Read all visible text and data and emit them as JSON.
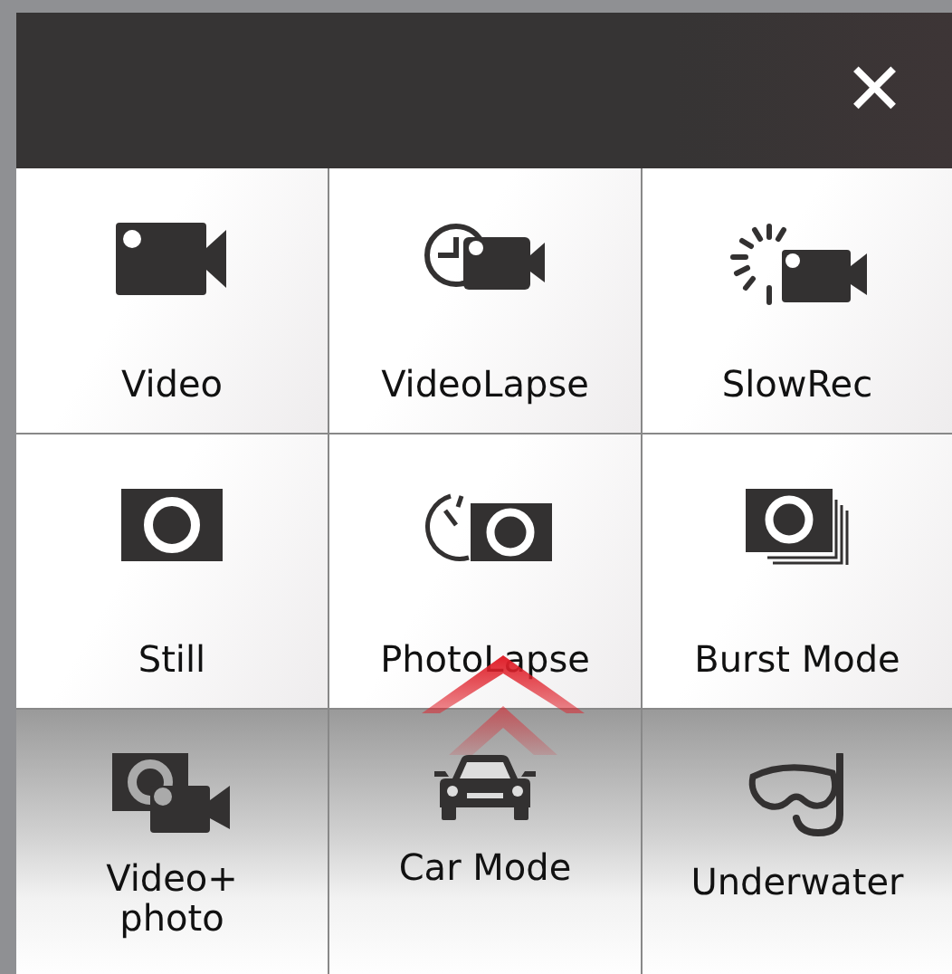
{
  "header": {
    "close_label": "✕"
  },
  "modes": [
    {
      "label": "Video",
      "kind": "video"
    },
    {
      "label": "VideoLapse",
      "kind": "videolapse"
    },
    {
      "label": "SlowRec",
      "kind": "slowrec"
    },
    {
      "label": "Still",
      "kind": "still"
    },
    {
      "label": "PhotoLapse",
      "kind": "photolapse"
    },
    {
      "label": "Burst Mode",
      "kind": "burst"
    },
    {
      "label": "Video+\nphoto",
      "kind": "videophoto"
    },
    {
      "label": "Car Mode",
      "kind": "car"
    },
    {
      "label": "Underwater",
      "kind": "underwater"
    }
  ]
}
